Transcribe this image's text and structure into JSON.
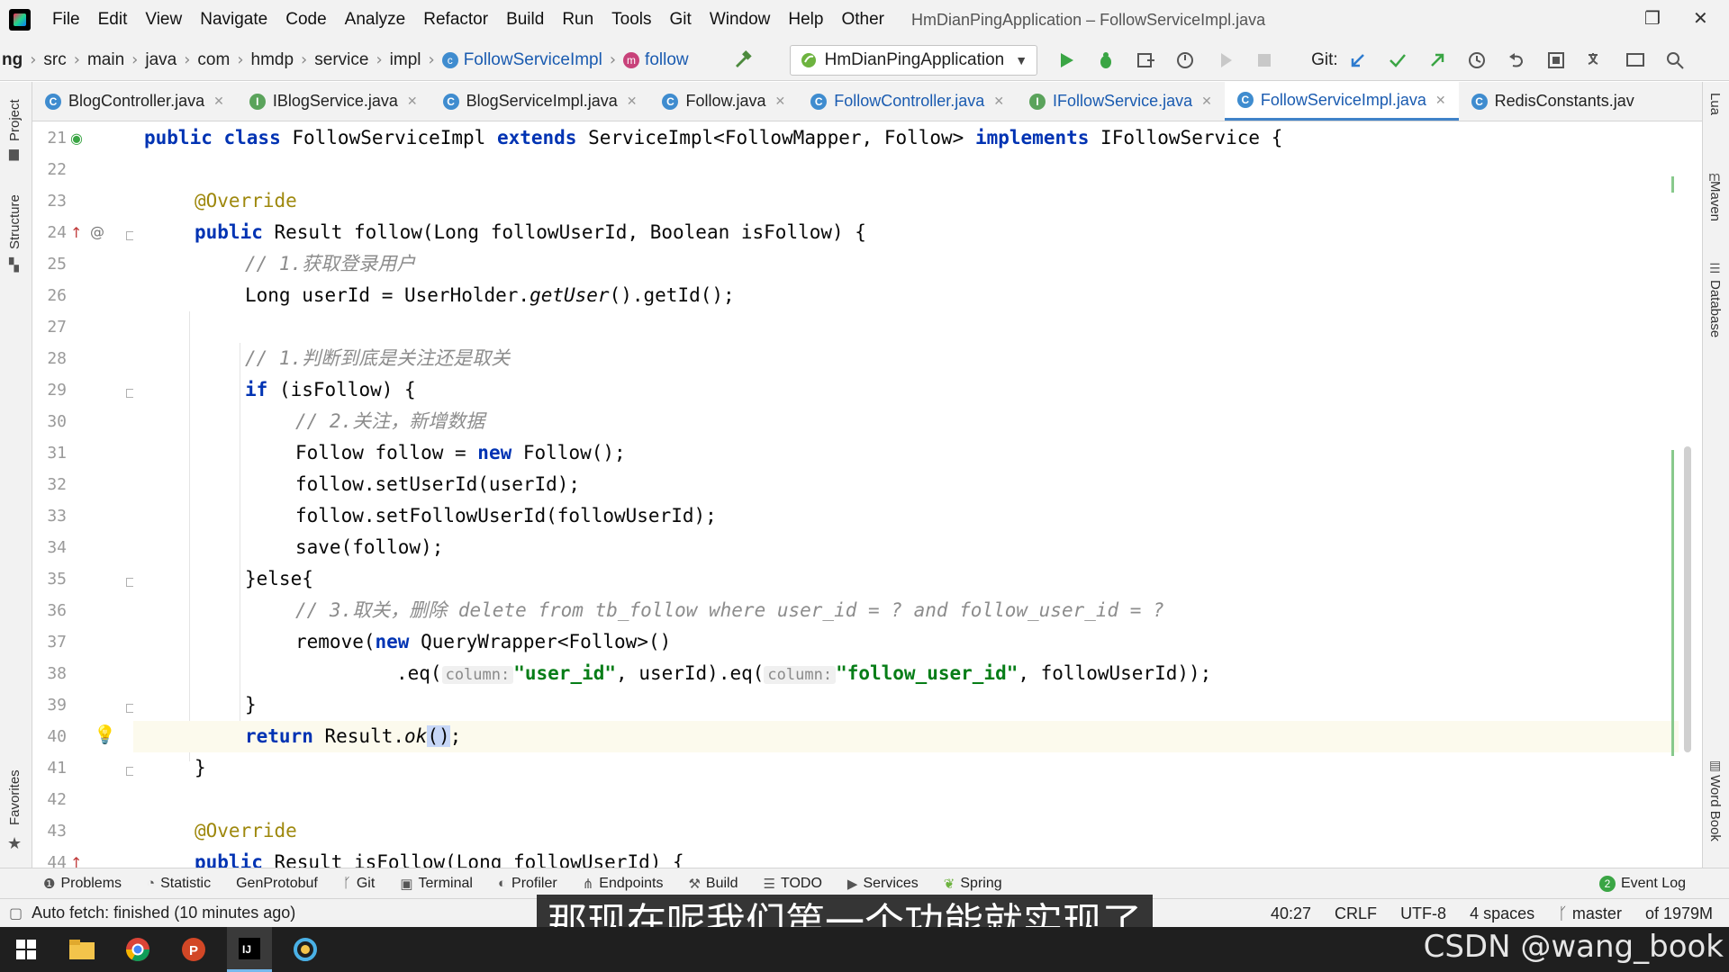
{
  "menubar": {
    "items": [
      "File",
      "Edit",
      "View",
      "Navigate",
      "Code",
      "Analyze",
      "Refactor",
      "Build",
      "Run",
      "Tools",
      "Git",
      "Window",
      "Help",
      "Other"
    ],
    "window_title": "HmDianPingApplication – FollowServiceImpl.java"
  },
  "breadcrumb": {
    "items": [
      "ng",
      "src",
      "main",
      "java",
      "com",
      "hmdp",
      "service",
      "impl",
      "FollowServiceImpl",
      "follow"
    ]
  },
  "toolbar": {
    "run_config": "HmDianPingApplication",
    "git_label": "Git:"
  },
  "tabs": [
    {
      "label": "BlogController.java",
      "icon": "C",
      "color": "#3f8ccf"
    },
    {
      "label": "IBlogService.java",
      "icon": "I",
      "color": "#5aa35b"
    },
    {
      "label": "BlogServiceImpl.java",
      "icon": "C",
      "color": "#3f8ccf"
    },
    {
      "label": "Follow.java",
      "icon": "C",
      "color": "#3f8ccf"
    },
    {
      "label": "FollowController.java",
      "icon": "C",
      "color": "#3f8ccf"
    },
    {
      "label": "IFollowService.java",
      "icon": "I",
      "color": "#5aa35b"
    },
    {
      "label": "FollowServiceImpl.java",
      "icon": "C",
      "color": "#3f8ccf"
    },
    {
      "label": "RedisConstants.jav",
      "icon": "C",
      "color": "#3f8ccf"
    }
  ],
  "left_strip": {
    "project": "Project",
    "structure": "Structure",
    "favorites": "Favorites"
  },
  "right_strip": {
    "lua": "Lua",
    "maven": "Maven",
    "database": "Database",
    "wordbook": "Word Book"
  },
  "code": {
    "line_numbers": [
      "21",
      "22",
      "23",
      "24",
      "25",
      "26",
      "27",
      "28",
      "29",
      "30",
      "31",
      "32",
      "33",
      "34",
      "35",
      "36",
      "37",
      "38",
      "39",
      "40",
      "41",
      "42",
      "43",
      "44"
    ],
    "l21_a": "public class",
    "l21_b": " FollowServiceImpl ",
    "l21_c": "extends",
    "l21_d": " ServiceImpl<FollowMapper, Follow> ",
    "l21_e": "implements",
    "l21_f": " IFollowService {",
    "l23": "@Override",
    "l24_a": "public",
    "l24_b": " Result follow(Long followUserId, Boolean isFollow) {",
    "l25": "// 1.获取登录用户",
    "l26_a": "Long userId = UserHolder.",
    "l26_b": "getUser",
    "l26_c": "().getId();",
    "l28": "// 1.判断到底是关注还是取关",
    "l29_a": "if",
    "l29_b": " (isFollow) {",
    "l30": "// 2.关注，新增数据",
    "l31_a": "Follow follow = ",
    "l31_b": "new",
    "l31_c": " Follow();",
    "l32": "follow.setUserId(userId);",
    "l33": "follow.setFollowUserId(followUserId);",
    "l34": "save(follow);",
    "l35": "}else{",
    "l36": "// 3.取关，删除 delete from tb_follow where user_id = ? and follow_user_id = ?",
    "l37_a": "remove(",
    "l37_b": "new",
    "l37_c": " QueryWrapper<Follow>()",
    "l38_a": ".eq(",
    "l38_hint1": "column:",
    "l38_s1": "\"user_id\"",
    "l38_b": ", userId).eq(",
    "l38_hint2": "column:",
    "l38_s2": "\"follow_user_id\"",
    "l38_c": ", followUserId));",
    "l39": "}",
    "l40_a": "return",
    "l40_b": " Result.",
    "l40_c": "ok",
    "l40_d": "()",
    "l40_e": ";",
    "l41": "}",
    "l43": "@Override",
    "l44_a": "public",
    "l44_b": " Result isFollow(Long followUserId) {"
  },
  "bottom_tools": [
    "Problems",
    "Statistic",
    "GenProtobuf",
    "Git",
    "Terminal",
    "Profiler",
    "Endpoints",
    "Build",
    "TODO",
    "Services",
    "Spring"
  ],
  "event_log": {
    "count": "2",
    "label": "Event Log"
  },
  "status": {
    "message": "Auto fetch: finished (10 minutes ago)",
    "position": "40:27",
    "line_sep": "CRLF",
    "encoding": "UTF-8",
    "indent": "4 spaces",
    "branch": "master",
    "memory": "of 1979M"
  },
  "subtitle": "那现在呢我们第一个功能就实现了",
  "watermark": "CSDN @wang_book"
}
